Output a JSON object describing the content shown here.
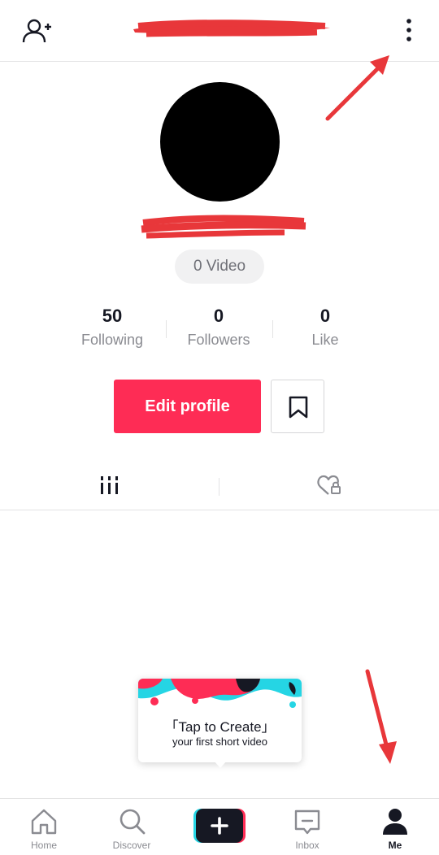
{
  "header": {
    "add_user_icon": "add-user-icon",
    "more_icon": "more-vertical-icon"
  },
  "profile": {
    "video_count": "0 Video",
    "stats": [
      {
        "value": "50",
        "label": "Following"
      },
      {
        "value": "0",
        "label": "Followers"
      },
      {
        "value": "0",
        "label": "Like"
      }
    ],
    "edit_profile_label": "Edit profile",
    "bookmark_icon": "bookmark-icon"
  },
  "tabs": {
    "videos_icon": "grid-icon",
    "liked_icon": "heart-lock-icon"
  },
  "create_tip": {
    "title": "「Tap to Create」",
    "subtitle": "your first short video"
  },
  "bottom_nav": {
    "items": [
      {
        "label": "Home",
        "icon": "home-icon"
      },
      {
        "label": "Discover",
        "icon": "search-icon"
      },
      {
        "label": "",
        "icon": "plus-icon"
      },
      {
        "label": "Inbox",
        "icon": "inbox-icon"
      },
      {
        "label": "Me",
        "icon": "person-icon"
      }
    ]
  },
  "colors": {
    "accent": "#fe2c55",
    "annotation": "#e8373a",
    "text_primary": "#161823",
    "text_secondary": "#8a8b91"
  }
}
